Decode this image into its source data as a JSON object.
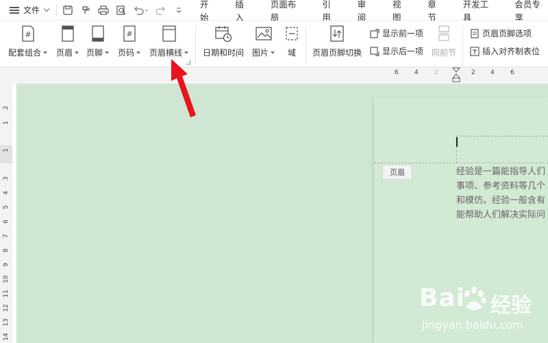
{
  "menubar": {
    "file_label": "文件",
    "tabs": [
      "开始",
      "插入",
      "页面布局",
      "引用",
      "审阅",
      "视图",
      "章节",
      "开发工具",
      "会员专享"
    ]
  },
  "ribbon": {
    "buttons": [
      {
        "label": "配套组合",
        "icon": "hash-page-icon"
      },
      {
        "label": "页眉",
        "icon": "header-page-icon"
      },
      {
        "label": "页脚",
        "icon": "footer-page-icon"
      },
      {
        "label": "页码",
        "icon": "page-number-icon"
      },
      {
        "label": "页眉横线",
        "icon": "header-line-icon"
      },
      {
        "label": "日期和时间",
        "icon": "calendar-clock-icon"
      },
      {
        "label": "图片",
        "icon": "picture-icon"
      },
      {
        "label": "域",
        "icon": "field-icon"
      },
      {
        "label": "页眉页脚切换",
        "icon": "switch-header-footer-icon"
      }
    ],
    "show_prev": "显示前一项",
    "show_next": "显示后一项",
    "same_section": "同前节",
    "hf_options": "页眉页脚选项",
    "insert_align_tab": "插入对齐制表位"
  },
  "ruler": {
    "top_numbers": [
      "6",
      "4",
      "2",
      "2",
      "4",
      "6"
    ],
    "left_numbers": [
      "2",
      "1",
      "1",
      "3",
      "4",
      "5",
      "6",
      "7",
      "8",
      "9",
      "10",
      "11",
      "12",
      "13",
      "14"
    ]
  },
  "document": {
    "header_tag": "页眉",
    "lines": [
      "经验是一篇能指导人们",
      "事项、参考资料等几个",
      "和模仿。经验一般含有",
      "能帮助人们解决实际问"
    ]
  },
  "watermark": {
    "brand": "Bai",
    "brand_cn": "经验",
    "url": "jingyan.baidu.com"
  },
  "colors": {
    "workspace": "#cfe6d2",
    "arrow": "#e8141b"
  }
}
